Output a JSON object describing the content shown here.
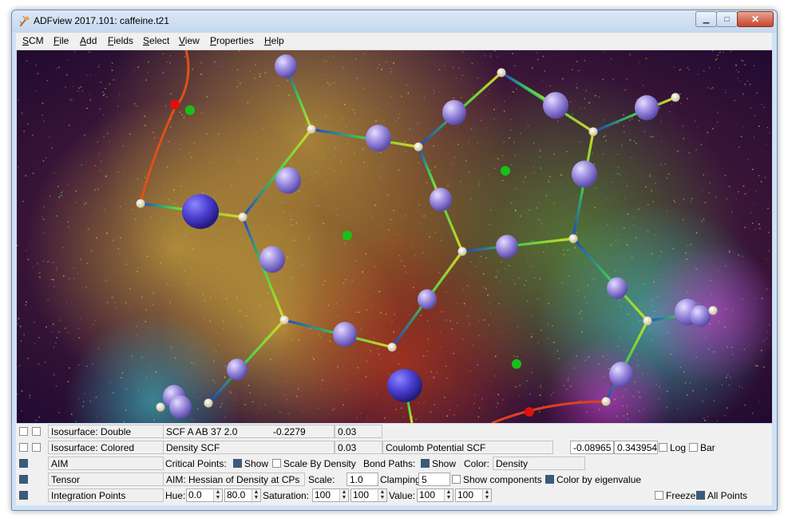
{
  "window": {
    "title": "ADFview 2017.101: caffeine.t21",
    "icon": "adf-app-icon",
    "controls": {
      "minimize": "▁",
      "maximize": "□",
      "close": "✕"
    }
  },
  "menu": [
    {
      "label": "SCM",
      "accel": "S",
      "rest": "CM"
    },
    {
      "label": "File",
      "accel": "F",
      "rest": "ile"
    },
    {
      "label": "Add",
      "accel": "A",
      "rest": "dd"
    },
    {
      "label": "Fields",
      "accel": "F",
      "rest": "ields"
    },
    {
      "label": "Select",
      "accel": "S",
      "rest": "elect"
    },
    {
      "label": "View",
      "accel": "V",
      "rest": "iew"
    },
    {
      "label": "Properties",
      "accel": "P",
      "rest": "roperties"
    },
    {
      "label": "Help",
      "accel": "H",
      "rest": "elp"
    }
  ],
  "colors": {
    "background": "#2a0e3a",
    "atom_sphere": "#9d8ee0",
    "core_point": "#fffbe0",
    "bond_low": "#1e3fd0",
    "bond_mid": "#3cd64a",
    "bond_high": "#e0e020",
    "cp_green": "#18c018",
    "cp_red": "#e01010",
    "cp_white": "#f4f4f4"
  },
  "panel": {
    "rows": [
      {
        "name": "Isosurface: Double",
        "show": false,
        "select": false,
        "field": "SCF A AB 37 2.0",
        "value1": "-0.2279",
        "value2": "0.03"
      },
      {
        "name": "Isosurface: Colored",
        "show": false,
        "select": false,
        "field": "Density SCF",
        "value": "0.03",
        "color_field": "Coulomb Potential SCF",
        "range_min": "-0.08965",
        "range_max": "0.343954",
        "log_label": "Log",
        "bar_label": "Bar"
      },
      {
        "name": "AIM",
        "show": true,
        "critical_points_label": "Critical Points:",
        "critical_show": "Show",
        "scale_by_density": "Scale By Density",
        "bond_paths_label": "Bond Paths:",
        "bond_show": "Show",
        "color_label": "Color:",
        "color_value": "Density"
      },
      {
        "name": "Tensor",
        "show": true,
        "field": "AIM: Hessian of Density at CPs",
        "scale_label": "Scale:",
        "scale_value": "1.0",
        "clamping_label": "Clamping:",
        "clamping_value": "5",
        "show_components": "Show components",
        "color_by_eigen": "Color by eigenvalue"
      },
      {
        "name": "Integration Points",
        "show": true,
        "hue_label": "Hue:",
        "hue_min": "0.0",
        "hue_max": "80.0",
        "saturation_label": "Saturation:",
        "sat_min": "100",
        "sat_max": "100",
        "value_label": "Value:",
        "val_min": "100",
        "val_max": "100",
        "freeze": "Freeze",
        "all_points": "All Points"
      }
    ]
  }
}
